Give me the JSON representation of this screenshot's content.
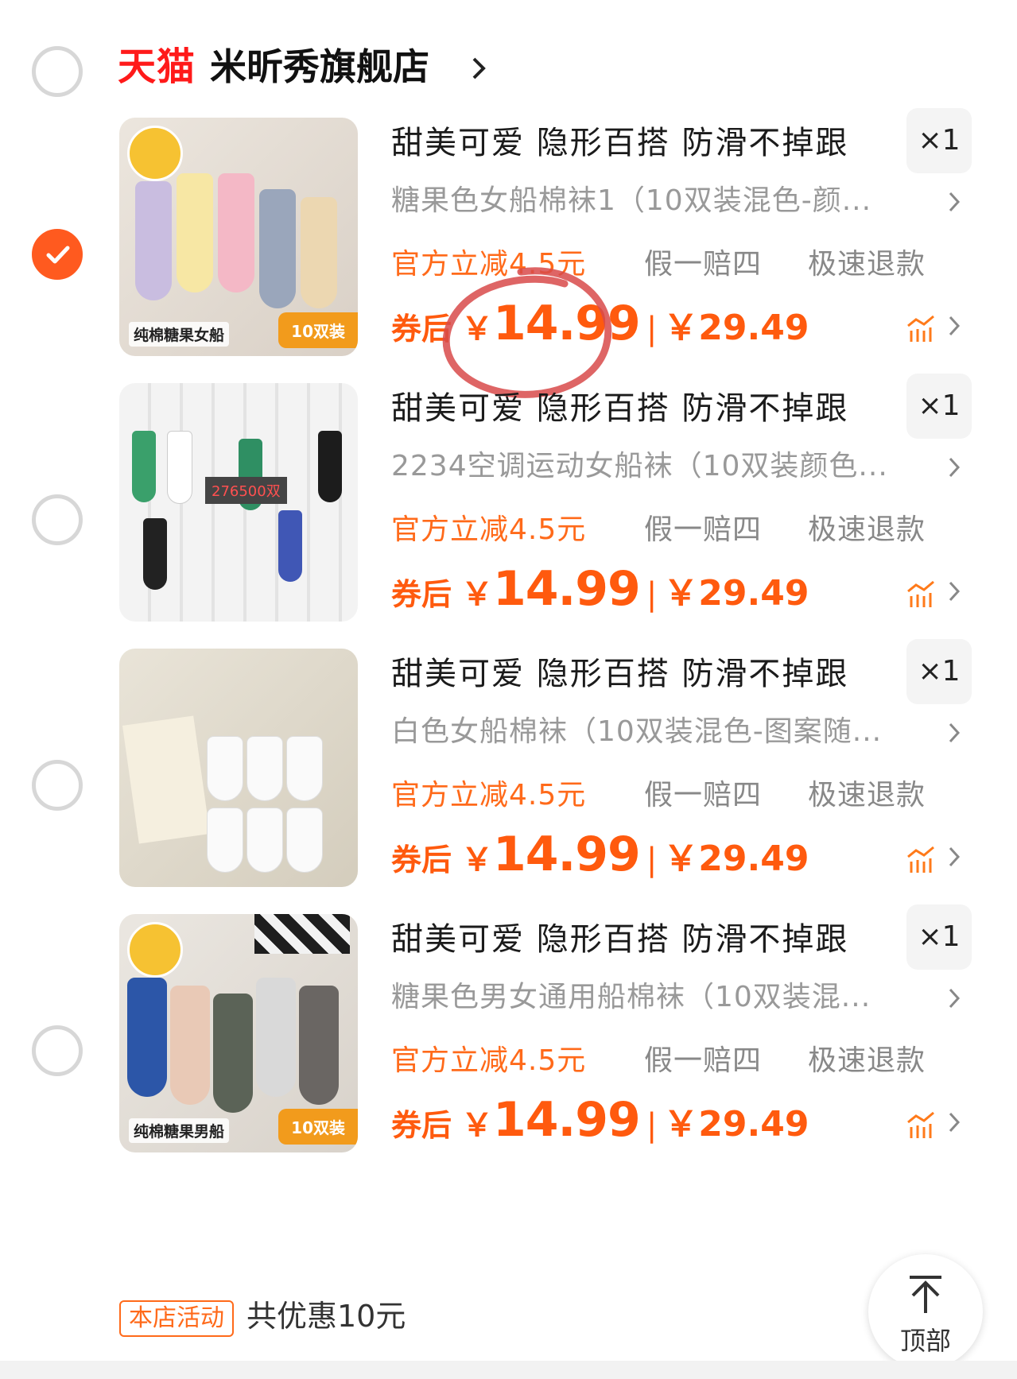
{
  "store": {
    "platform": "天猫",
    "name": "米昕秀旗舰店",
    "selected": false
  },
  "colors": {
    "accent": "#ff5a0e",
    "tmall": "#ff1a1a",
    "muted": "#999999"
  },
  "items": [
    {
      "selected": true,
      "title": "甜美可爱 隐形百搭 防滑不掉跟",
      "qty": "×1",
      "sku": "糖果色女船棉袜1（10双装混色-颜...",
      "promo_discount": "官方立减4.5元",
      "promo_fake": "假一赔四",
      "promo_refund": "极速退款",
      "after_label": "券后",
      "yen": "￥",
      "after_price": "14.99",
      "separator": "|",
      "orig_price": "￥29.49",
      "thumb_label": "纯棉糖果女船",
      "thumb_badge": "10双装"
    },
    {
      "selected": false,
      "title": "甜美可爱 隐形百搭 防滑不掉跟",
      "qty": "×1",
      "sku": "2234空调运动女船袜（10双装颜色...",
      "promo_discount": "官方立减4.5元",
      "promo_fake": "假一赔四",
      "promo_refund": "极速退款",
      "after_label": "券后",
      "yen": "￥",
      "after_price": "14.99",
      "separator": "|",
      "orig_price": "￥29.49",
      "thumb_label": "276500双"
    },
    {
      "selected": false,
      "title": "甜美可爱 隐形百搭 防滑不掉跟",
      "qty": "×1",
      "sku": "白色女船棉袜（10双装混色-图案随...",
      "promo_discount": "官方立减4.5元",
      "promo_fake": "假一赔四",
      "promo_refund": "极速退款",
      "after_label": "券后",
      "yen": "￥",
      "after_price": "14.99",
      "separator": "|",
      "orig_price": "￥29.49"
    },
    {
      "selected": false,
      "title": "甜美可爱 隐形百搭 防滑不掉跟",
      "qty": "×1",
      "sku": "糖果色男女通用船棉袜（10双装混...",
      "promo_discount": "官方立减4.5元",
      "promo_fake": "假一赔四",
      "promo_refund": "极速退款",
      "after_label": "券后",
      "yen": "￥",
      "after_price": "14.99",
      "separator": "|",
      "orig_price": "￥29.49",
      "thumb_label": "纯棉糖果男船",
      "thumb_badge": "10双装"
    }
  ],
  "footer": {
    "activity_tag": "本店活动",
    "activity_text": "共优惠10元",
    "top_button_label": "顶部"
  }
}
